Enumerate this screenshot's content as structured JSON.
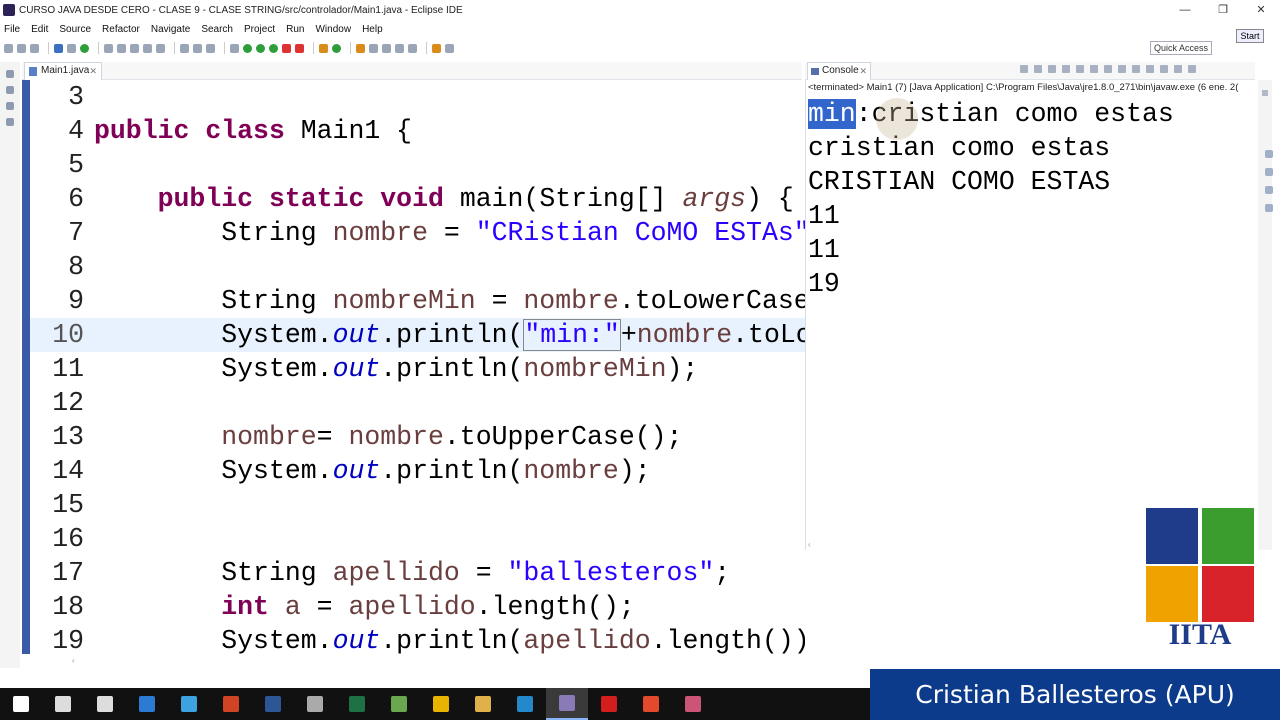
{
  "window": {
    "title": "CURSO JAVA  DESDE CERO - CLASE 9 - CLASE STRING/src/controlador/Main1.java - Eclipse IDE",
    "controls": [
      "—",
      "❐",
      "✕"
    ]
  },
  "menu": [
    "File",
    "Edit",
    "Source",
    "Refactor",
    "Navigate",
    "Search",
    "Project",
    "Run",
    "Window",
    "Help"
  ],
  "toolbar": {
    "quick_access": "Quick Access",
    "start": "Start"
  },
  "editor": {
    "tab_label": "Main1.java",
    "close_glyph": "✕",
    "current_line": "10",
    "lines": [
      {
        "n": "3"
      },
      {
        "n": "4"
      },
      {
        "n": "5"
      },
      {
        "n": "6"
      },
      {
        "n": "7"
      },
      {
        "n": "8"
      },
      {
        "n": "9"
      },
      {
        "n": "10"
      },
      {
        "n": "11"
      },
      {
        "n": "12"
      },
      {
        "n": "13"
      },
      {
        "n": "14"
      },
      {
        "n": "15"
      },
      {
        "n": "16"
      },
      {
        "n": "17"
      },
      {
        "n": "18"
      },
      {
        "n": "19"
      }
    ],
    "tokens": {
      "l4_public": "public",
      "l4_class": "class",
      "l4_name": "Main1 {",
      "l6_public": "public",
      "l6_static": "static",
      "l6_void": "void",
      "l6_main": "main(String[] ",
      "l6_args": "args",
      "l6_end": ") {",
      "l7_type": "String ",
      "l7_var": "nombre",
      "l7_eq": " = ",
      "l7_str": "\"CRistian CoMO ESTAs\"",
      "l7_end": ";",
      "l9_type": "String ",
      "l9_var": "nombreMin",
      "l9_eq": " = ",
      "l9_ref": "nombre",
      "l9_call": ".toLowerCase(",
      "l10_sys": "System.",
      "l10_out": "out",
      "l10_print": ".println(",
      "l10_str": "\"min:\"",
      "l10_plus": "+",
      "l10_ref": "nombre",
      "l10_call": ".toLow",
      "l11_sys": "System.",
      "l11_out": "out",
      "l11_print": ".println(",
      "l11_ref": "nombreMin",
      "l11_end": ");",
      "l13_ref": "nombre",
      "l13_eq": "= ",
      "l13_ref2": "nombre",
      "l13_call": ".toUpperCase();",
      "l14_sys": "System.",
      "l14_out": "out",
      "l14_print": ".println(",
      "l14_ref": "nombre",
      "l14_end": ");",
      "l17_type": "String ",
      "l17_var": "apellido",
      "l17_eq": " = ",
      "l17_str": "\"ballesteros\"",
      "l17_end": ";",
      "l18_int": "int",
      "l18_var": "a",
      "l18_eq": " = ",
      "l18_ref": "apellido",
      "l18_call": ".length();",
      "l19_sys": "System.",
      "l19_out": "out",
      "l19_print": ".println(",
      "l19_ref": "apellido",
      "l19_call": ".length());"
    }
  },
  "console": {
    "tab_label": "Console",
    "close_glyph": "✕",
    "header": "<terminated> Main1 (7) [Java Application] C:\\Program Files\\Java\\jre1.8.0_271\\bin\\javaw.exe (6 ene. 2(",
    "first_selected": "min",
    "first_rest": ":cristian como estas",
    "lines": [
      "cristian como estas",
      "CRISTIAN COMO ESTAS",
      "11",
      "11",
      "19"
    ]
  },
  "logo": {
    "text": "IITA",
    "colors": [
      "#1e3c8a",
      "#3b9d2e",
      "#f0a300",
      "#d8232a"
    ]
  },
  "banner": {
    "text": "Cristian Ballesteros (APU)",
    "color": "#0d3b8c"
  },
  "taskbar": {
    "apps": [
      {
        "name": "windows-start-icon",
        "color": "#ffffff"
      },
      {
        "name": "search-icon",
        "color": "#dddddd"
      },
      {
        "name": "task-view-icon",
        "color": "#dddddd"
      },
      {
        "name": "photoshop-icon",
        "color": "#2b7bd3"
      },
      {
        "name": "app-icon",
        "color": "#3ca3e0"
      },
      {
        "name": "powerpoint-icon",
        "color": "#d04423"
      },
      {
        "name": "word-icon",
        "color": "#2b5797"
      },
      {
        "name": "app2-icon",
        "color": "#aaaaaa"
      },
      {
        "name": "excel-icon",
        "color": "#1e7145"
      },
      {
        "name": "app3-icon",
        "color": "#6aa84f"
      },
      {
        "name": "chrome-icon",
        "color": "#e8b400"
      },
      {
        "name": "folder-icon",
        "color": "#e0b14a"
      },
      {
        "name": "vscode-icon",
        "color": "#2489ca"
      },
      {
        "name": "eclipse-icon",
        "color": "#8a7ab8"
      },
      {
        "name": "acrobat-icon",
        "color": "#d21e1e"
      },
      {
        "name": "app4-icon",
        "color": "#e34a2c"
      },
      {
        "name": "app5-icon",
        "color": "#cc5577"
      }
    ]
  }
}
